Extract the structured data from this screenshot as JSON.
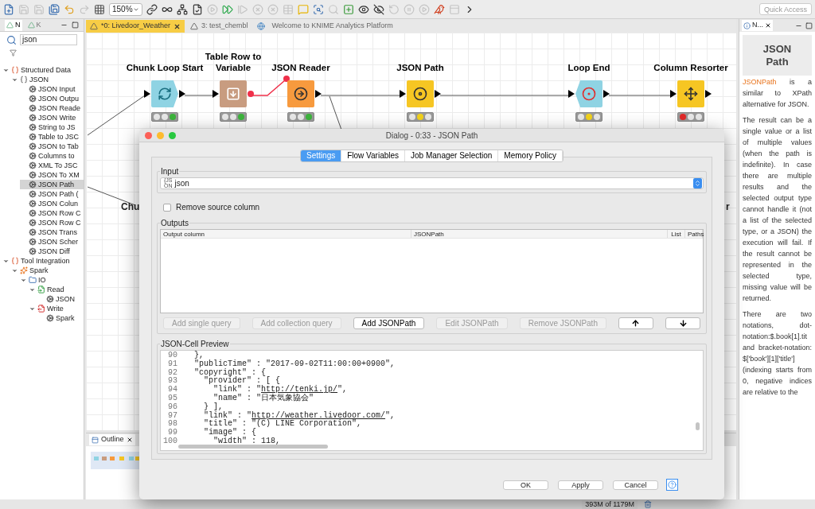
{
  "toolbar": {
    "icons": [
      {
        "kind": "new",
        "disabled": false
      },
      {
        "kind": "save",
        "disabled": true
      },
      {
        "kind": "save_as",
        "disabled": true
      },
      {
        "kind": "save_all",
        "disabled": false
      },
      {
        "kind": "undo",
        "disabled": false
      },
      {
        "kind": "redo",
        "disabled": true
      },
      {
        "kind": "grid",
        "disabled": false
      }
    ],
    "zoom": "150%",
    "icons_2": [
      {
        "kind": "connect",
        "disabled": false
      },
      {
        "kind": "loop",
        "disabled": false
      },
      {
        "kind": "tree",
        "disabled": false
      },
      {
        "kind": "config",
        "disabled": false
      },
      {
        "kind": "play",
        "disabled": true
      },
      {
        "kind": "play_all",
        "disabled": false
      },
      {
        "kind": "step",
        "disabled": true
      },
      {
        "kind": "stop",
        "disabled": true
      },
      {
        "kind": "stop_all",
        "disabled": true
      },
      {
        "kind": "table",
        "disabled": true
      },
      {
        "kind": "comment",
        "disabled": false
      },
      {
        "kind": "inspect",
        "disabled": false
      },
      {
        "kind": "search",
        "disabled": true
      },
      {
        "kind": "add",
        "disabled": false
      },
      {
        "kind": "show",
        "disabled": false
      },
      {
        "kind": "hide",
        "disabled": false
      },
      {
        "kind": "reset",
        "disabled": true
      },
      {
        "kind": "pause",
        "disabled": true
      },
      {
        "kind": "resume",
        "disabled": true
      },
      {
        "kind": "bird",
        "disabled": false
      },
      {
        "kind": "layout",
        "disabled": true
      },
      {
        "kind": "more",
        "disabled": false
      }
    ],
    "quick_access": {
      "placeholder": "Quick Access"
    }
  },
  "left_panel": {
    "tabs": [
      {
        "label": "N",
        "selected": true
      },
      {
        "label": "K",
        "selected": false
      }
    ],
    "search": "json",
    "tree": [
      {
        "label": "Structured Data",
        "kind": "category",
        "selected": false,
        "expanded": true,
        "children": [
          {
            "label": "JSON",
            "kind": "json",
            "selected": false,
            "expanded": true,
            "children": [
              {
                "label": "JSON Input",
                "kind": "node",
                "selected": false
              },
              {
                "label": "JSON Outpu",
                "kind": "node",
                "selected": false
              },
              {
                "label": "JSON Reade",
                "kind": "node",
                "selected": false
              },
              {
                "label": "JSON Write",
                "kind": "node",
                "selected": false
              },
              {
                "label": "String to JS",
                "kind": "node",
                "selected": false
              },
              {
                "label": "Table to JSC",
                "kind": "node",
                "selected": false
              },
              {
                "label": "JSON to Tab",
                "kind": "node",
                "selected": false
              },
              {
                "label": "Columns to",
                "kind": "node",
                "selected": false
              },
              {
                "label": "XML To JSC",
                "kind": "node",
                "selected": false
              },
              {
                "label": "JSON To XM",
                "kind": "node",
                "selected": false
              },
              {
                "label": "JSON Path",
                "kind": "node",
                "selected": true
              },
              {
                "label": "JSON Path (",
                "kind": "node",
                "selected": false
              },
              {
                "label": "JSON Colun",
                "kind": "node",
                "selected": false
              },
              {
                "label": "JSON Row C",
                "kind": "node",
                "selected": false
              },
              {
                "label": "JSON Row C",
                "kind": "node",
                "selected": false
              },
              {
                "label": "JSON Trans",
                "kind": "node",
                "selected": false
              },
              {
                "label": "JSON Scher",
                "kind": "node",
                "selected": false
              },
              {
                "label": "JSON Diff",
                "kind": "node",
                "selected": false
              }
            ]
          }
        ]
      },
      {
        "label": "Tool Integration",
        "kind": "category",
        "selected": false,
        "expanded": true,
        "children": [
          {
            "label": "Spark",
            "kind": "spark",
            "selected": false,
            "expanded": true,
            "children": [
              {
                "label": "IO",
                "kind": "folder",
                "selected": false,
                "expanded": true,
                "children": [
                  {
                    "label": "Read",
                    "kind": "read",
                    "selected": false,
                    "expanded": true,
                    "children": [
                      {
                        "label": "JSON",
                        "kind": "node",
                        "selected": false
                      }
                    ]
                  },
                  {
                    "label": "Write",
                    "kind": "write",
                    "selected": false,
                    "expanded": true,
                    "children": [
                      {
                        "label": "Spark",
                        "kind": "node",
                        "selected": false
                      }
                    ]
                  }
                ]
              }
            ]
          }
        ]
      }
    ]
  },
  "editor_tabs": [
    {
      "label": "*0: Livedoor_Weather",
      "kind": "workflow",
      "selected": true
    },
    {
      "label": "3: test_chembl",
      "kind": "workflow",
      "selected": false
    },
    {
      "label": "Welcome to KNIME Analytics Platform",
      "kind": "web",
      "selected": false
    }
  ],
  "canvas": {
    "nodes": [
      {
        "label": "Chunk Loop Start",
        "kind": "loop_start",
        "color": "#8fd3e3",
        "red": false,
        "yellow": false,
        "green": true
      },
      {
        "label": "Table Row to Variable",
        "kind": "variable",
        "color": "#c89c80",
        "red": false,
        "yellow": false,
        "green": true
      },
      {
        "label": "JSON Reader",
        "kind": "reader",
        "color": "#f79a3e",
        "red": false,
        "yellow": false,
        "green": true
      },
      {
        "label": "JSON Path",
        "kind": "path",
        "color": "#f6c623",
        "red": false,
        "yellow": true,
        "green": false
      },
      {
        "label": "Loop End",
        "kind": "loop_end",
        "color": "#8fd3e3",
        "red": false,
        "yellow": true,
        "green": false
      },
      {
        "label": "Column Resorter",
        "kind": "resorter",
        "color": "#f6c623",
        "red": true,
        "yellow": false,
        "green": false
      }
    ],
    "hidden_labels": [
      "Chu",
      "r"
    ]
  },
  "outline": {
    "tab": "Outline"
  },
  "status_bar": {
    "memory": "393M of 1179M"
  },
  "help_panel": {
    "tab": "N...",
    "title": "JSON Path",
    "link": "JSONPath",
    "intro": " is a similar to XPath alternative for JSON.",
    "paragraphs": [
      "The result can be a single value or a list of multiple values (when the path is indefinite). In case there are multiple results and the selected output type cannot handle it (not a list of the selected type, or a JSON) the execution will fail. If the result cannot be represented in the selected type, missing value will be returned.",
      "There are two notations, dot-notation:$.book[1].tit and bracket-notation: $['book'][1]['title'] (indexing starts from 0, negative indices are relative to the"
    ]
  },
  "dialog": {
    "title": "Dialog - 0:33 - JSON Path",
    "tabs": [
      {
        "label": "Settings",
        "selected": true
      },
      {
        "label": "Flow Variables",
        "selected": false
      },
      {
        "label": "Job Manager Selection",
        "selected": false
      },
      {
        "label": "Memory Policy",
        "selected": false
      }
    ],
    "input": {
      "legend": "Input",
      "badge": [
        "{JS",
        "ON"
      ],
      "value": "json"
    },
    "remove_source": {
      "label": "Remove source column",
      "checked": false
    },
    "outputs": {
      "legend": "Outputs",
      "columns": [
        "Output column",
        "JSONPath",
        "List",
        "Paths"
      ],
      "buttons": [
        {
          "label": "Add single query",
          "kind": "text",
          "disabled": true
        },
        {
          "label": "Add collection query",
          "kind": "text",
          "disabled": true
        },
        {
          "label": "Add JSONPath",
          "kind": "text",
          "disabled": false
        },
        {
          "label": "Edit JSONPath",
          "kind": "text",
          "disabled": true
        },
        {
          "label": "Remove JSONPath",
          "kind": "text",
          "disabled": true
        },
        {
          "kind": "up",
          "disabled": false
        },
        {
          "kind": "down",
          "disabled": false
        }
      ]
    },
    "preview": {
      "legend": "JSON-Cell Preview",
      "lines": [
        {
          "number": "90",
          "code": "  },"
        },
        {
          "number": "91",
          "code": "  \"publicTime\" : \"2017-09-02T11:00:00+0900\","
        },
        {
          "number": "92",
          "code": "  \"copyright\" : {"
        },
        {
          "number": "93",
          "code": "    \"provider\" : [ {"
        },
        {
          "number": "94",
          "code": "      \"link\" : \"",
          "link": "http://tenki.jp/",
          "after": "\","
        },
        {
          "number": "95",
          "code": "      \"name\" : \"日本気象協会\""
        },
        {
          "number": "96",
          "code": "    } ],"
        },
        {
          "number": "97",
          "code": "    \"link\" : \"",
          "link": "http://weather.livedoor.com/",
          "after": "\","
        },
        {
          "number": "98",
          "code": "    \"title\" : \"(C) LINE Corporation\","
        },
        {
          "number": "99",
          "code": "    \"image\" : {"
        },
        {
          "number": "100",
          "code": "      \"width\" : 118,"
        }
      ]
    },
    "buttons": [
      "OK",
      "Apply",
      "Cancel"
    ]
  }
}
